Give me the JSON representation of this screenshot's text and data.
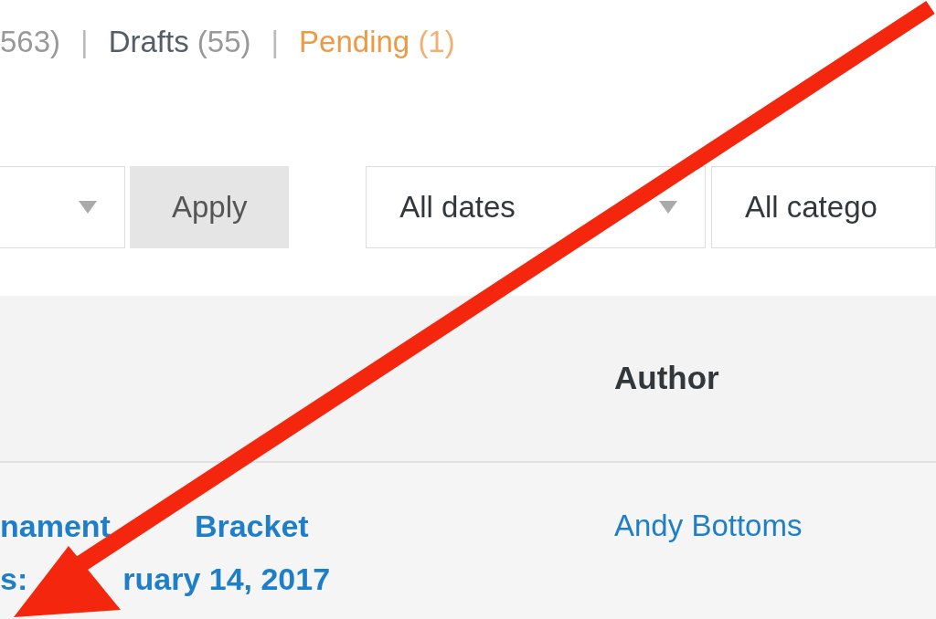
{
  "status_links": [
    {
      "kind": "count_only",
      "count": "563)",
      "highlighted": false
    },
    {
      "kind": "separator",
      "text": "|"
    },
    {
      "kind": "link",
      "label": "Drafts",
      "count": "(55)",
      "highlighted": false
    },
    {
      "kind": "separator",
      "text": "|"
    },
    {
      "kind": "link",
      "label": "Pending",
      "count": "(1)",
      "highlighted": true
    }
  ],
  "filters": {
    "apply_button": "Apply",
    "date_filter": "All dates",
    "category_filter": "All catego"
  },
  "table": {
    "columns": [
      {
        "label": "Author"
      }
    ],
    "rows": [
      {
        "title_lines": [
          [
            "nament",
            "Bracket"
          ],
          [
            "s:",
            "ruary 14, 2017"
          ]
        ],
        "author": "Andy Bottoms"
      }
    ]
  },
  "annotation": {
    "kind": "arrow"
  }
}
